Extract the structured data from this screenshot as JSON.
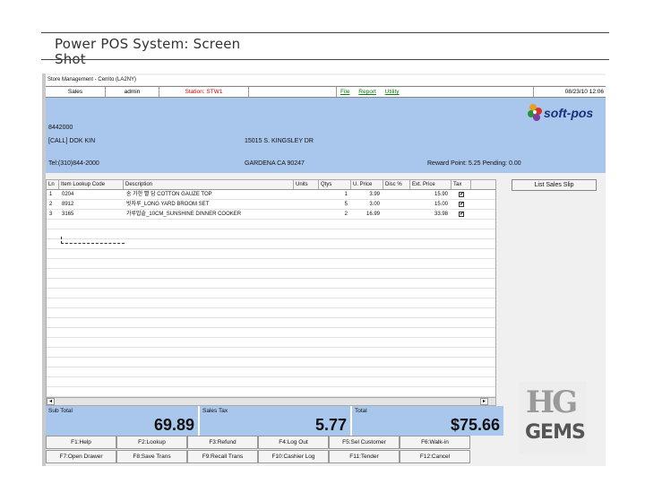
{
  "slide": {
    "title": "Power POS System: Screen Shot"
  },
  "window": {
    "title": "Store Management - Cerrito (LA2NY)"
  },
  "menubar": {
    "mode": "Sales",
    "user": "admin",
    "station": "Station: STW1",
    "menus": [
      "File",
      "Report",
      "Utility"
    ],
    "datetime": "08/23/10 12:06"
  },
  "customer": {
    "id": "8442000",
    "name": "[CALL] DOK KIN",
    "address1": "15015 S. KINGSLEY DR",
    "phone": "Tel:(310)844-2000",
    "address2": "GARDENA CA 90247",
    "reward": "Reward Point: 5.25  Pending: 0.00"
  },
  "brand": {
    "logo_text": "soft-pos"
  },
  "grid": {
    "columns": [
      "Ln",
      "Item Lookup Code",
      "Description",
      "Units",
      "Qtys",
      "U. Price",
      "Disc %",
      "Ext. Price",
      "Tax"
    ],
    "rows": [
      {
        "ln": "1",
        "code": "0204",
        "desc": "송 가한 빨 담 COTTON GAUZE TOP",
        "units": "",
        "qty": "1",
        "price": "3.99",
        "disc": "",
        "ext": "15.90",
        "tax": "✔"
      },
      {
        "ln": "2",
        "code": "8912",
        "desc": "빗자루_LONG YARD BROOM SET",
        "units": "",
        "qty": "5",
        "price": "3.00",
        "disc": "",
        "ext": "15.00",
        "tax": "✔"
      },
      {
        "ln": "3",
        "code": "3165",
        "desc": "가루밥솥_10CM_SUNSHINE DINNER COOKER",
        "units": "",
        "qty": "2",
        "price": "16.99",
        "disc": "",
        "ext": "33.98",
        "tax": "✔"
      }
    ]
  },
  "scroll": {
    "left_arrow": "◂",
    "right_arrow": "▸"
  },
  "buttons": {
    "list_sales_slip": "List Sales Slip"
  },
  "totals": {
    "subtotal_label": "Sub Total",
    "subtotal": "69.89",
    "tax_label": "Sales Tax",
    "tax": "5.77",
    "total_label": "Total",
    "total": "$75.66"
  },
  "gems_logo": {
    "top": "HG",
    "bottom": "GEMS"
  },
  "fkeys": [
    "F1:Help",
    "F2:Lookup",
    "F3:Refund",
    "F4:Log Out",
    "F5:Sel Customer",
    "F6:Walk-in",
    "F7:Open Drawer",
    "F8:Save Trans",
    "F9:Recall Trans",
    "F10:Cashier Log",
    "F11:Tender",
    "F12:Cancel"
  ],
  "colors": {
    "panel_blue": "#a9c6ec",
    "station_red": "#cc0000",
    "menu_green": "#117711"
  }
}
